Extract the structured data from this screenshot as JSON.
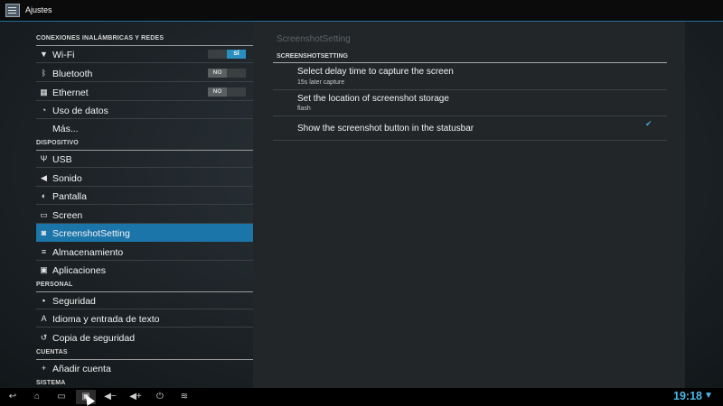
{
  "app": {
    "title": "Ajustes",
    "icon": "settings-app-icon"
  },
  "sidebar": {
    "sections": [
      {
        "header": "CONEXIONES INALÁMBRICAS Y REDES"
      },
      {
        "header": "DISPOSITIVO"
      },
      {
        "header": "PERSONAL"
      },
      {
        "header": "CUENTAS"
      },
      {
        "header": "SISTEMA"
      }
    ],
    "items": [
      {
        "label": "Wi-Fi",
        "icon": "wifi-icon",
        "toggle": "SÍ"
      },
      {
        "label": "Bluetooth",
        "icon": "bluetooth-icon",
        "toggle": "NO"
      },
      {
        "label": "Ethernet",
        "icon": "ethernet-icon",
        "toggle": "NO"
      },
      {
        "label": "Uso de datos",
        "icon": "data-usage-icon"
      },
      {
        "label": "Más..."
      },
      {
        "label": "USB",
        "icon": "usb-icon"
      },
      {
        "label": "Sonido",
        "icon": "sound-icon"
      },
      {
        "label": "Pantalla",
        "icon": "display-icon"
      },
      {
        "label": "Screen",
        "icon": "screen-icon"
      },
      {
        "label": "ScreenshotSetting",
        "icon": "screenshot-icon",
        "selected": true
      },
      {
        "label": "Almacenamiento",
        "icon": "storage-icon"
      },
      {
        "label": "Aplicaciones",
        "icon": "apps-icon"
      },
      {
        "label": "Seguridad",
        "icon": "lock-icon"
      },
      {
        "label": "Idioma y entrada de texto",
        "icon": "language-icon"
      },
      {
        "label": "Copia de seguridad",
        "icon": "backup-icon"
      },
      {
        "label": "Añadir cuenta",
        "icon": "add-icon"
      }
    ]
  },
  "pane": {
    "title": "ScreenshotSetting",
    "section": "SCREENSHOTSETTING",
    "prefs": [
      {
        "title": "Select delay time to capture the screen",
        "summary": "15s later capture"
      },
      {
        "title": "Set the location of screenshot storage",
        "summary": "flash"
      },
      {
        "title": "Show the screenshot button in the statusbar",
        "checked": true
      }
    ]
  },
  "statusbar": {
    "clock": "19:18",
    "accent": "#4db8ea",
    "nav_icons": [
      "back-icon",
      "home-icon",
      "recents-icon",
      "screenshot-icon",
      "volume-down-icon",
      "volume-up-icon",
      "power-icon",
      "menu-collapse-icon"
    ]
  },
  "colors": {
    "selected": "#1b75a9",
    "accent": "#4db8ea"
  }
}
